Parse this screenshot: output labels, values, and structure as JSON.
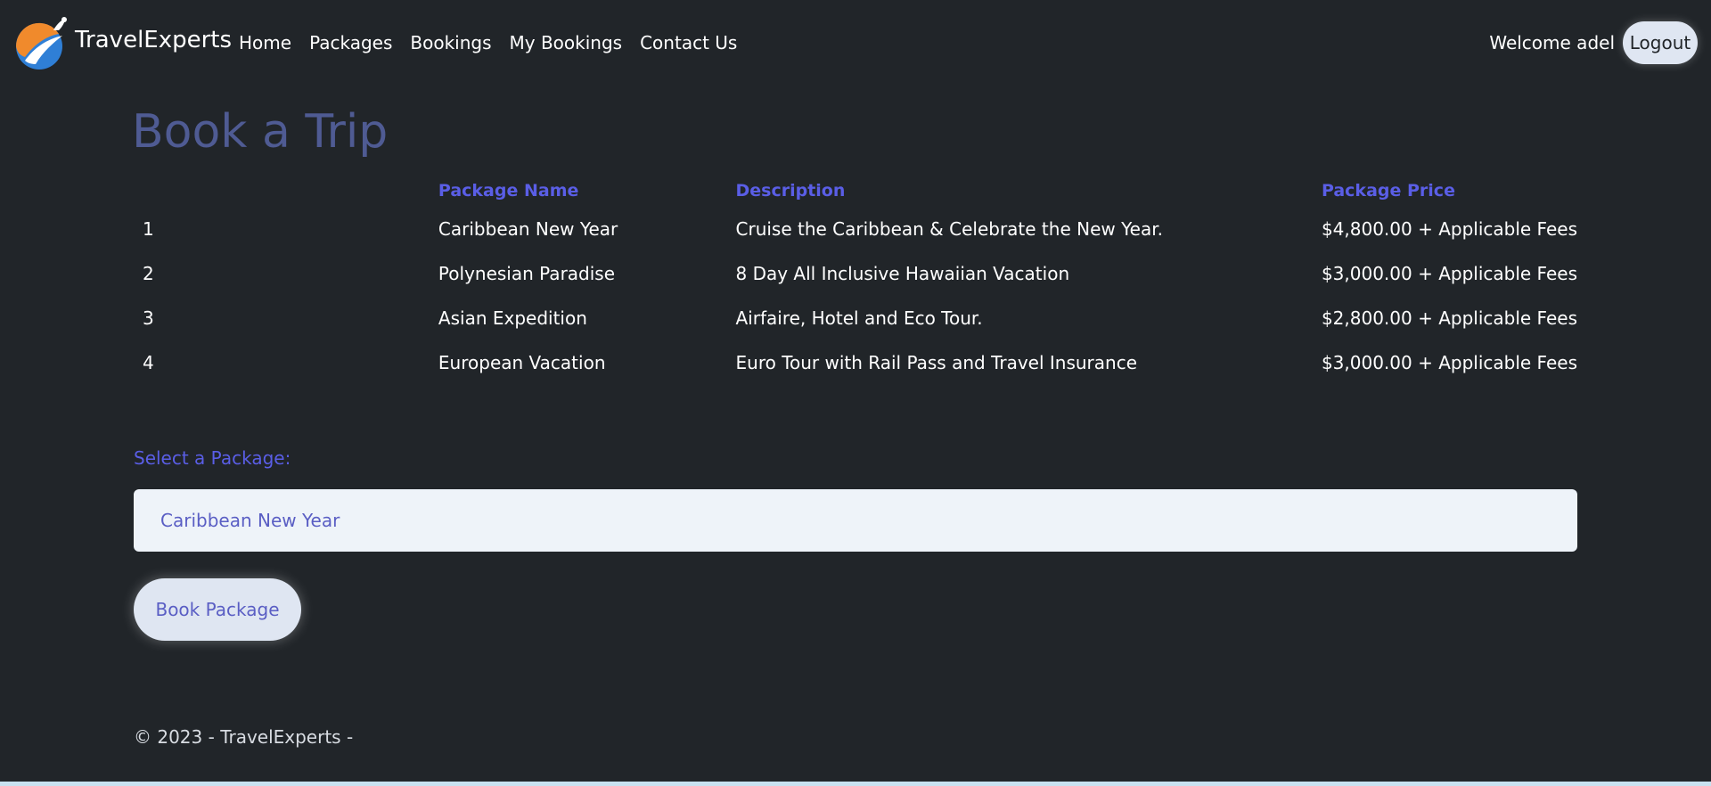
{
  "brand": {
    "name": "TravelExperts"
  },
  "nav": {
    "items": [
      {
        "label": "Home"
      },
      {
        "label": "Packages"
      },
      {
        "label": "Bookings"
      },
      {
        "label": "My Bookings"
      },
      {
        "label": "Contact Us"
      }
    ],
    "welcome": "Welcome adel",
    "logout_label": "Logout"
  },
  "main": {
    "title": "Book a Trip",
    "table": {
      "headers": [
        "",
        "Package Name",
        "Description",
        "Package Price"
      ],
      "rows": [
        {
          "id": "1",
          "name": "Caribbean New Year",
          "description": "Cruise the Caribbean & Celebrate the New Year.",
          "price": "$4,800.00 + Applicable Fees"
        },
        {
          "id": "2",
          "name": "Polynesian Paradise",
          "description": "8 Day All Inclusive Hawaiian Vacation",
          "price": "$3,000.00 + Applicable Fees"
        },
        {
          "id": "3",
          "name": "Asian Expedition",
          "description": "Airfaire, Hotel and Eco Tour.",
          "price": "$2,800.00 + Applicable Fees"
        },
        {
          "id": "4",
          "name": "European Vacation",
          "description": "Euro Tour with Rail Pass and Travel Insurance",
          "price": "$3,000.00 + Applicable Fees"
        }
      ]
    },
    "select_label": "Select a Package:",
    "selected_package": "Caribbean New Year",
    "book_button_label": "Book Package"
  },
  "footer": {
    "text": "© 2023 - TravelExperts -"
  },
  "colors": {
    "background": "#212529",
    "accent": "#5a5ee6",
    "title": "#4f5b93"
  }
}
